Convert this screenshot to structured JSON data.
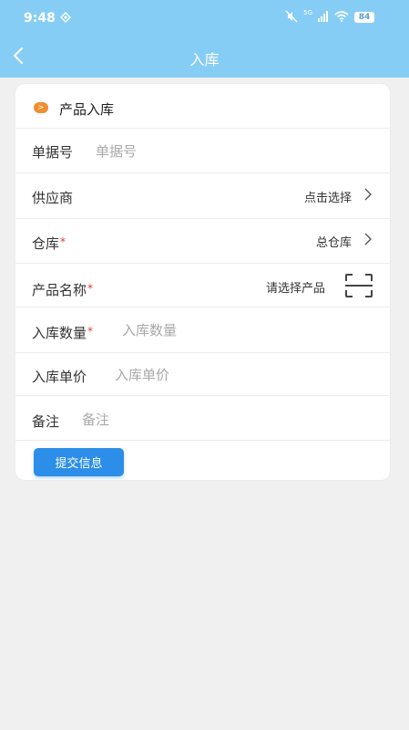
{
  "status_bar": {
    "time": "9:48",
    "network": "5G",
    "battery": "84"
  },
  "nav": {
    "title": "入库"
  },
  "section": {
    "title": "产品入库",
    "dot_glyph": ">"
  },
  "form": {
    "doc_no": {
      "label": "单据号",
      "placeholder": "单据号"
    },
    "supplier": {
      "label": "供应商",
      "value": "点击选择"
    },
    "warehouse": {
      "label": "仓库",
      "required_mark": "*",
      "value": "总仓库"
    },
    "product": {
      "label": "产品名称",
      "required_mark": "*",
      "value": "请选择产品"
    },
    "qty": {
      "label": "入库数量",
      "required_mark": "*",
      "placeholder": "入库数量"
    },
    "price": {
      "label": "入库单价",
      "placeholder": "入库单价"
    },
    "remark": {
      "label": "备注",
      "placeholder": "备注"
    }
  },
  "submit_label": "提交信息",
  "colors": {
    "header": "#86cdf6",
    "accent": "#2c8ee8",
    "required": "#e23b2c",
    "section_dot": "#ef8f2f"
  }
}
